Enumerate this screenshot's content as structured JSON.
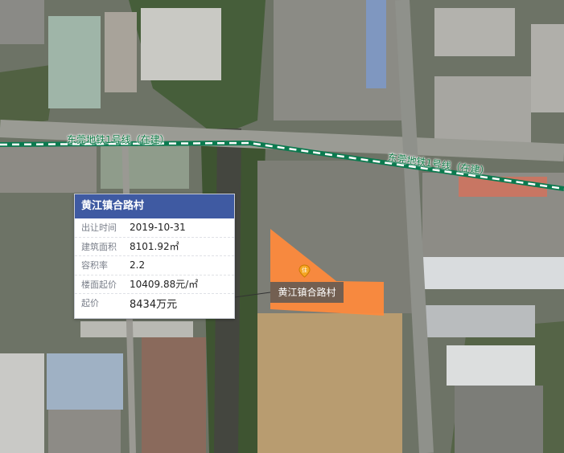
{
  "map": {
    "metro_line_label_1": "东莞地铁1号线（在建）",
    "metro_line_label_2": "东莞地铁1号线（在建）",
    "plot_label": "黄江镇合路村",
    "pin_icon": "location-pin-icon",
    "colors": {
      "plot_fill": "#fe8a3c",
      "metro_line": "#0b7a4f",
      "popup_header": "#3f5aa2"
    }
  },
  "popup": {
    "title": "黄江镇合路村",
    "rows": [
      {
        "key": "出让时间",
        "value": "2019-10-31"
      },
      {
        "key": "建筑面积",
        "value": "8101.92㎡"
      },
      {
        "key": "容积率",
        "value": "2.2"
      },
      {
        "key": "楼面起价",
        "value": "10409.88元/㎡"
      },
      {
        "key": "起价",
        "value": "8434万元"
      }
    ]
  }
}
